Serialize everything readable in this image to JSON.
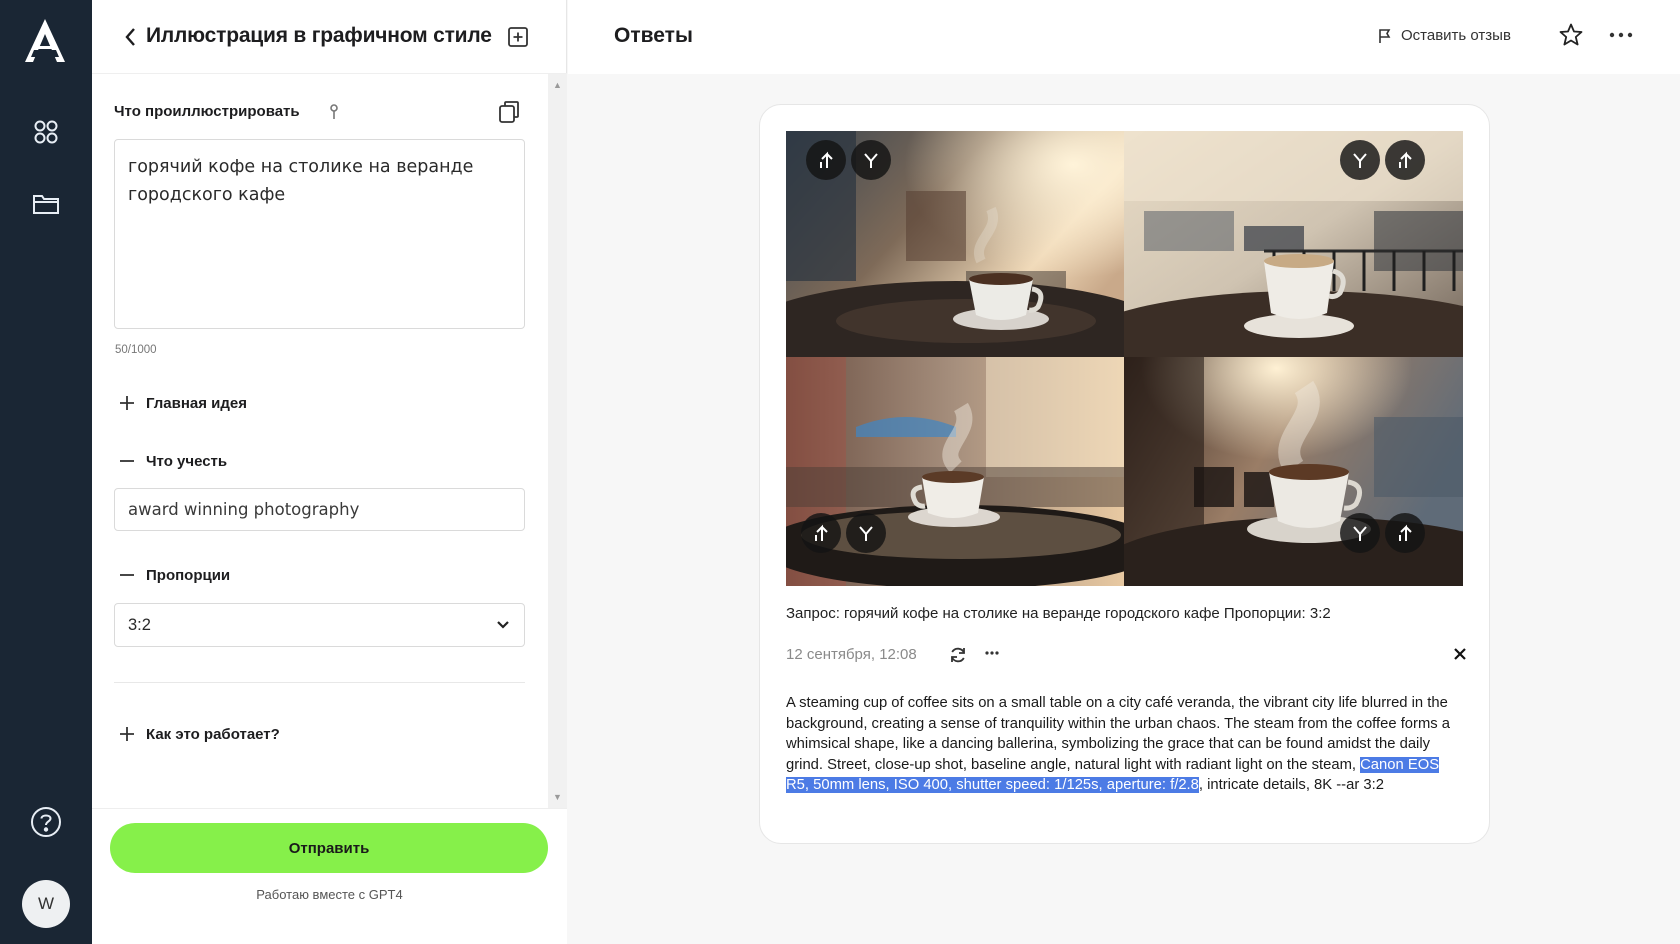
{
  "rail": {
    "icons": [
      "logo-icon",
      "apps-grid-icon",
      "folder-icon",
      "help-icon"
    ],
    "avatar_letter": "W"
  },
  "panel": {
    "title": "Иллюстрация в графичном стиле",
    "prompt_label": "Что проиллюстрировать",
    "prompt_value": "горячий кофе на столике на веранде городского кафе",
    "counter": "50/1000",
    "main_idea_label": "Главная идея",
    "consider_label": "Что учесть",
    "consider_value": "award winning photography",
    "proportions_label": "Пропорции",
    "proportions_value": "3:2",
    "how_it_works_label": "Как это работает?",
    "send_label": "Отправить",
    "gpt_note": "Работаю вместе с GPT4"
  },
  "main": {
    "title": "Ответы",
    "feedback_label": "Оставить отзыв",
    "query": "Запрос: горячий кофе на столике на веранде городского кафе Пропорции: 3:2",
    "date": "12 сентября, 12:08",
    "description_plain": "A steaming cup of coffee sits on a small table on a city café veranda, the vibrant city life blurred in the background, creating a sense of tranquility within the urban chaos. The steam from the coffee forms a whimsical shape, like a dancing ballerina, symbolizing the grace that can be found amidst the daily grind. Street, close-up shot, baseline angle, natural light with radiant light on the steam, ",
    "description_highlight": "Canon EOS R5, 50mm lens, ISO 400, shutter speed: 1/125s, aperture: f/2.8",
    "description_tail": ", intricate details, 8K --ar 3:2",
    "images": [
      {
        "alt": "coffee-cup-street-1",
        "controls": [
          "upscale-icon",
          "variation-icon"
        ]
      },
      {
        "alt": "coffee-cup-street-2",
        "controls": [
          "variation-icon",
          "upscale-icon"
        ]
      },
      {
        "alt": "coffee-cup-street-3",
        "controls": [
          "upscale-icon",
          "variation-icon"
        ]
      },
      {
        "alt": "coffee-cup-street-4",
        "controls": [
          "variation-icon",
          "upscale-icon"
        ]
      }
    ]
  },
  "colors": {
    "rail_bg": "#1a2634",
    "send_button": "#86f04a",
    "highlight": "#4c7be5"
  }
}
